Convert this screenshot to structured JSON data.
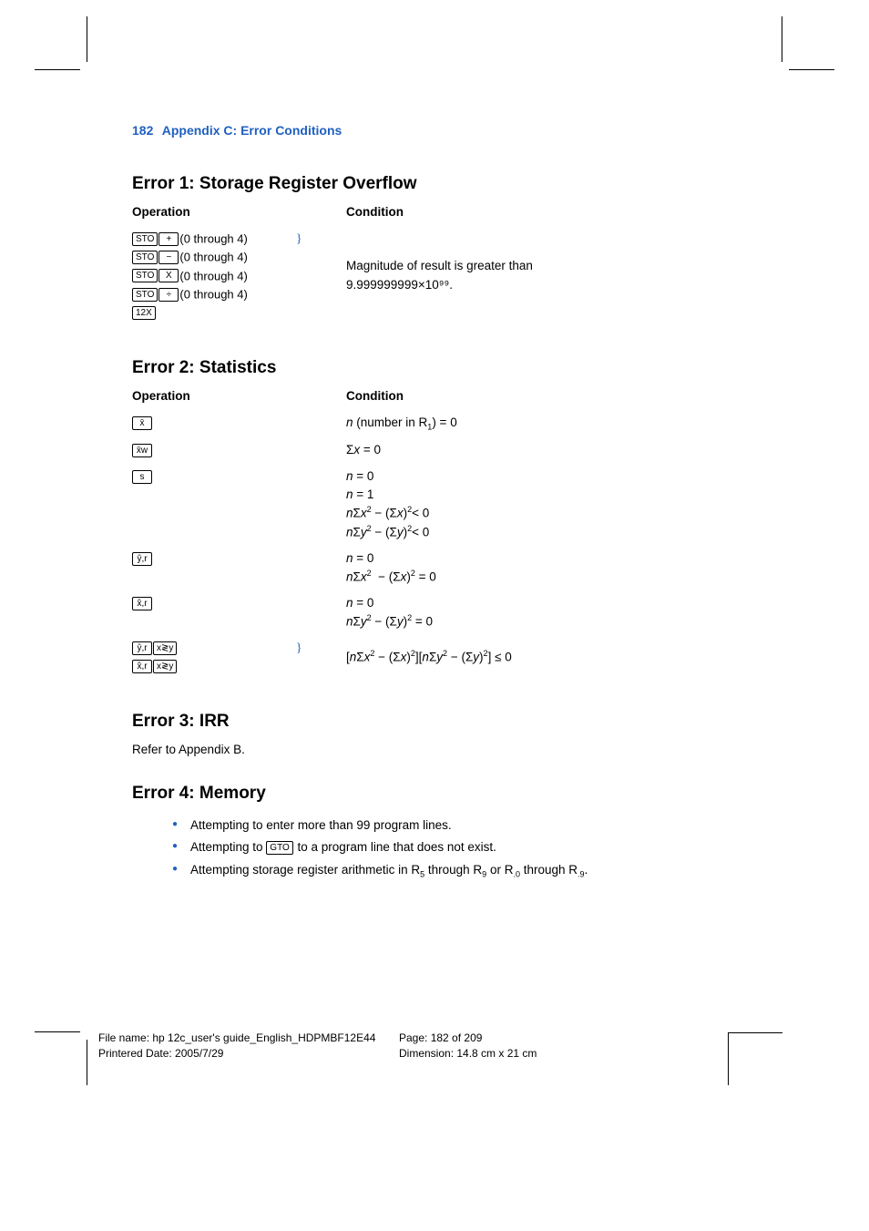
{
  "header": {
    "page_num": "182",
    "title": "Appendix C: Error Conditions"
  },
  "error1": {
    "heading": "Error 1: Storage Register Overflow",
    "operation_label": "Operation",
    "condition_label": "Condition",
    "ops": {
      "line1_suffix": "(0 through 4)",
      "line2_suffix": "(0 through 4)",
      "line3_suffix": "(0 through 4)",
      "line4_suffix": "(0 through 4)"
    },
    "keys": {
      "sto": "STO",
      "plus": "+",
      "minus": "−",
      "times": "X",
      "divide": "÷",
      "k12x": "12X"
    },
    "condition_line1": "Magnitude of result is greater than",
    "condition_line2": "9.999999999×10⁹⁹."
  },
  "error2": {
    "heading": "Error 2: Statistics",
    "operation_label": "Operation",
    "condition_label": "Condition",
    "keys": {
      "xbar": "x̄",
      "xbarw": "x̄w",
      "s": "s",
      "yhatr": "ŷ,r",
      "xhatr": "x̂,r",
      "xswapy": "x≷y"
    },
    "cond": {
      "row1": "n (number in R₁) = 0",
      "row2": "Σx = 0",
      "row3_1": "n = 0",
      "row3_2": "n = 1",
      "row3_3": "nΣx² − (Σx)²< 0",
      "row3_4": "nΣy² − (Σy)²< 0",
      "row4_1": "n = 0",
      "row4_2": "nΣx²  − (Σx)² = 0",
      "row5_1": "n = 0",
      "row5_2": "nΣy² − (Σy)² = 0",
      "row6": "[nΣx² − (Σx)²][nΣy² − (Σy)²] ≤ 0"
    }
  },
  "error3": {
    "heading": "Error 3: IRR",
    "text": "Refer to Appendix B."
  },
  "error4": {
    "heading": "Error 4: Memory",
    "bullet1": "Attempting to enter more than 99 program lines.",
    "bullet2_pre": "Attempting to ",
    "bullet2_key": "GTO",
    "bullet2_post": " to a program line that does not exist.",
    "bullet3": "Attempting storage register arithmetic in R₅ through R₉ or R.₀ through R.₉."
  },
  "footer": {
    "filename_label": "File name: hp 12c_user's guide_English_HDPMBF12E44",
    "printered_label": "Printered Date: 2005/7/29",
    "page_label": "Page: 182 of 209",
    "dimension_label": "Dimension: 14.8 cm x 21 cm"
  }
}
